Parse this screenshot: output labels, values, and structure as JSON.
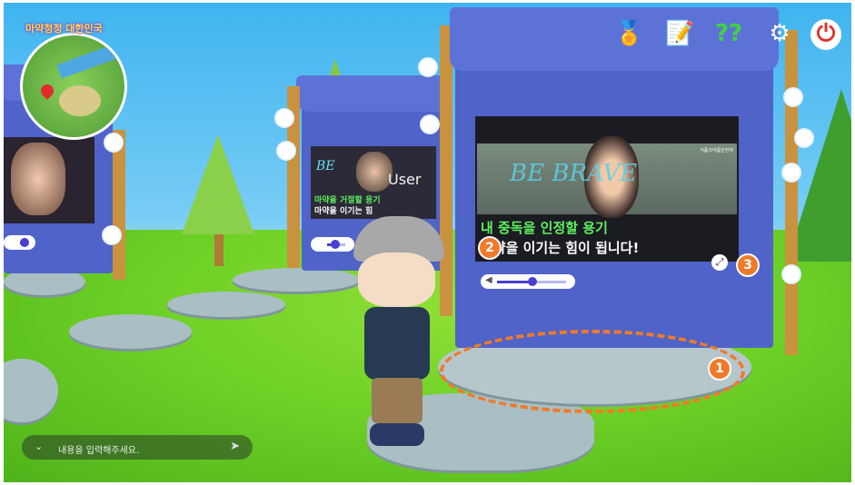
{
  "minimap": {
    "title": "마약청정 대한민국"
  },
  "hud": {
    "icons": [
      "medal-icon",
      "note-pencil-icon",
      "help-icon",
      "settings-icon",
      "power-icon"
    ],
    "help_label": "??"
  },
  "booth_main": {
    "screen_line1": "내 중독을 인정할 용기",
    "screen_line2": "마약을 이기는 힘이 됩니다!",
    "watermark": "BE BRAVE",
    "logo_text": "식품의약품안전처",
    "volume_level": 0.42
  },
  "booth_mid": {
    "overlay_name": "User",
    "screen_line1": "마약을 거절할 용기",
    "screen_line2": "마약을 이기는 힘",
    "watermark": "BE",
    "volume_level": 0.3
  },
  "booth_left": {
    "volume_level": 0.2
  },
  "callouts": [
    "1",
    "2",
    "3"
  ],
  "chat": {
    "placeholder": "내용을 입력해주세요."
  },
  "colors": {
    "accent": "#f07a2a",
    "booth": "#4f63c8",
    "grass": "#6ccf25"
  }
}
